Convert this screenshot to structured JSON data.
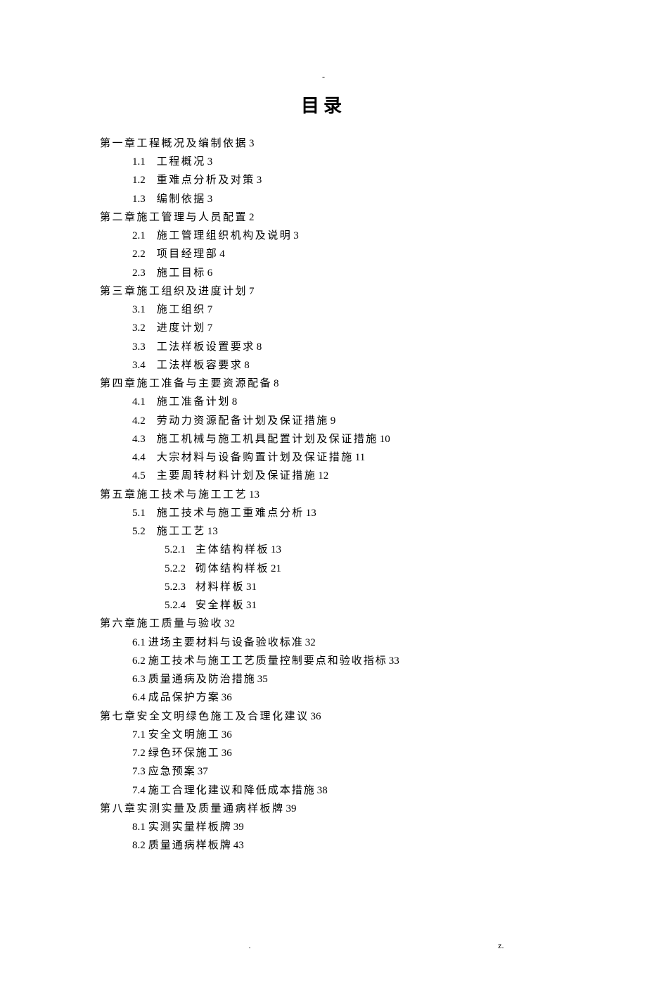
{
  "page_dash": "-",
  "title": "目录",
  "toc": [
    {
      "level": "l1",
      "label": "第一章",
      "title": "工程概况及编制依据",
      "page": "3"
    },
    {
      "level": "l2",
      "num": "1.1",
      "title": "工程概况",
      "page": "3"
    },
    {
      "level": "l2",
      "num": "1.2",
      "title": "重难点分析及对策",
      "page": "3"
    },
    {
      "level": "l2",
      "num": "1.3",
      "title": "编制依据",
      "page": "3"
    },
    {
      "level": "l1",
      "label": "第二章",
      "title": "施工管理与人员配置",
      "page": "2"
    },
    {
      "level": "l2",
      "num": "2.1",
      "title": "施工管理组织机构及说明",
      "page": "3"
    },
    {
      "level": "l2",
      "num": "2.2",
      "title": "项目经理部",
      "page": "4"
    },
    {
      "level": "l2",
      "num": "2.3",
      "title": "施工目标",
      "page": "6"
    },
    {
      "level": "l1",
      "label": "第三章",
      "title": "施工组织及进度计划",
      "page": "7"
    },
    {
      "level": "l2",
      "num": "3.1",
      "title": "施工组织",
      "page": "7"
    },
    {
      "level": "l2",
      "num": "3.2",
      "title": "进度计划",
      "page": "7"
    },
    {
      "level": "l2",
      "num": "3.3",
      "title": "工法样板设置要求",
      "page": "8"
    },
    {
      "level": "l2",
      "num": "3.4",
      "title": "工法样板容要求",
      "page": "8"
    },
    {
      "level": "l1",
      "label": "第四章",
      "title": "施工准备与主要资源配备",
      "page": "8"
    },
    {
      "level": "l2",
      "num": "4.1",
      "title": "施工准备计划",
      "page": "8"
    },
    {
      "level": "l2",
      "num": "4.2",
      "title": "劳动力资源配备计划及保证措施",
      "page": "9"
    },
    {
      "level": "l2",
      "num": "4.3",
      "title": "施工机械与施工机具配置计划及保证措施",
      "page": "10"
    },
    {
      "level": "l2",
      "num": "4.4",
      "title": "大宗材料与设备购置计划及保证措施",
      "page": "11"
    },
    {
      "level": "l2",
      "num": "4.5",
      "title": "主要周转材料计划及保证措施",
      "page": "12"
    },
    {
      "level": "l1",
      "label": "第五章",
      "title": "施工技术与施工工艺",
      "page": "13"
    },
    {
      "level": "l2",
      "num": "5.1",
      "title": "施工技术与施工重难点分析",
      "page": "13"
    },
    {
      "level": "l2",
      "num": "5.2",
      "title": "施工工艺",
      "page": "13"
    },
    {
      "level": "l3",
      "num": "5.2.1",
      "title": "主体结构样板",
      "page": "13"
    },
    {
      "level": "l3",
      "num": "5.2.2",
      "title": "砌体结构样板",
      "page": "21"
    },
    {
      "level": "l3",
      "num": "5.2.3",
      "title": "材料样板",
      "page": "31"
    },
    {
      "level": "l3",
      "num": "5.2.4",
      "title": "安全样板",
      "page": "31"
    },
    {
      "level": "l1",
      "label": "第六章",
      "title": "施工质量与验收",
      "page": "32"
    },
    {
      "level": "l2b",
      "num": "6.1",
      "title": "进场主要材料与设备验收标准",
      "page": "32"
    },
    {
      "level": "l2b",
      "num": "6.2",
      "title": "施工技术与施工工艺质量控制要点和验收指标",
      "page": "33"
    },
    {
      "level": "l2b",
      "num": "6.3",
      "title": "质量通病及防治措施",
      "page": "35"
    },
    {
      "level": "l2b",
      "num": "6.4",
      "title": "成品保护方案",
      "page": "36"
    },
    {
      "level": "l1",
      "label": "第七章",
      "title": "安全文明绿色施工及合理化建议",
      "page": "36"
    },
    {
      "level": "l2b",
      "num": "7.1",
      "title": "安全文明施工",
      "page": "36"
    },
    {
      "level": "l2b",
      "num": "7.2",
      "title": "绿色环保施工",
      "page": "36"
    },
    {
      "level": "l2b",
      "num": "7.3",
      "title": "应急预案",
      "page": "37"
    },
    {
      "level": "l2b",
      "num": "7.4",
      "title": "施工合理化建议和降低成本措施",
      "page": "38"
    },
    {
      "level": "l1",
      "label": "第八章",
      "title": "实测实量及质量通病样板牌",
      "page": "39"
    },
    {
      "level": "l2b",
      "num": "8.1",
      "title": "实测实量样板牌",
      "page": "39"
    },
    {
      "level": "l2b",
      "num": "8.2",
      "title": "质量通病样板牌",
      "page": "43"
    }
  ],
  "footer_left": ".",
  "footer_right": "z."
}
